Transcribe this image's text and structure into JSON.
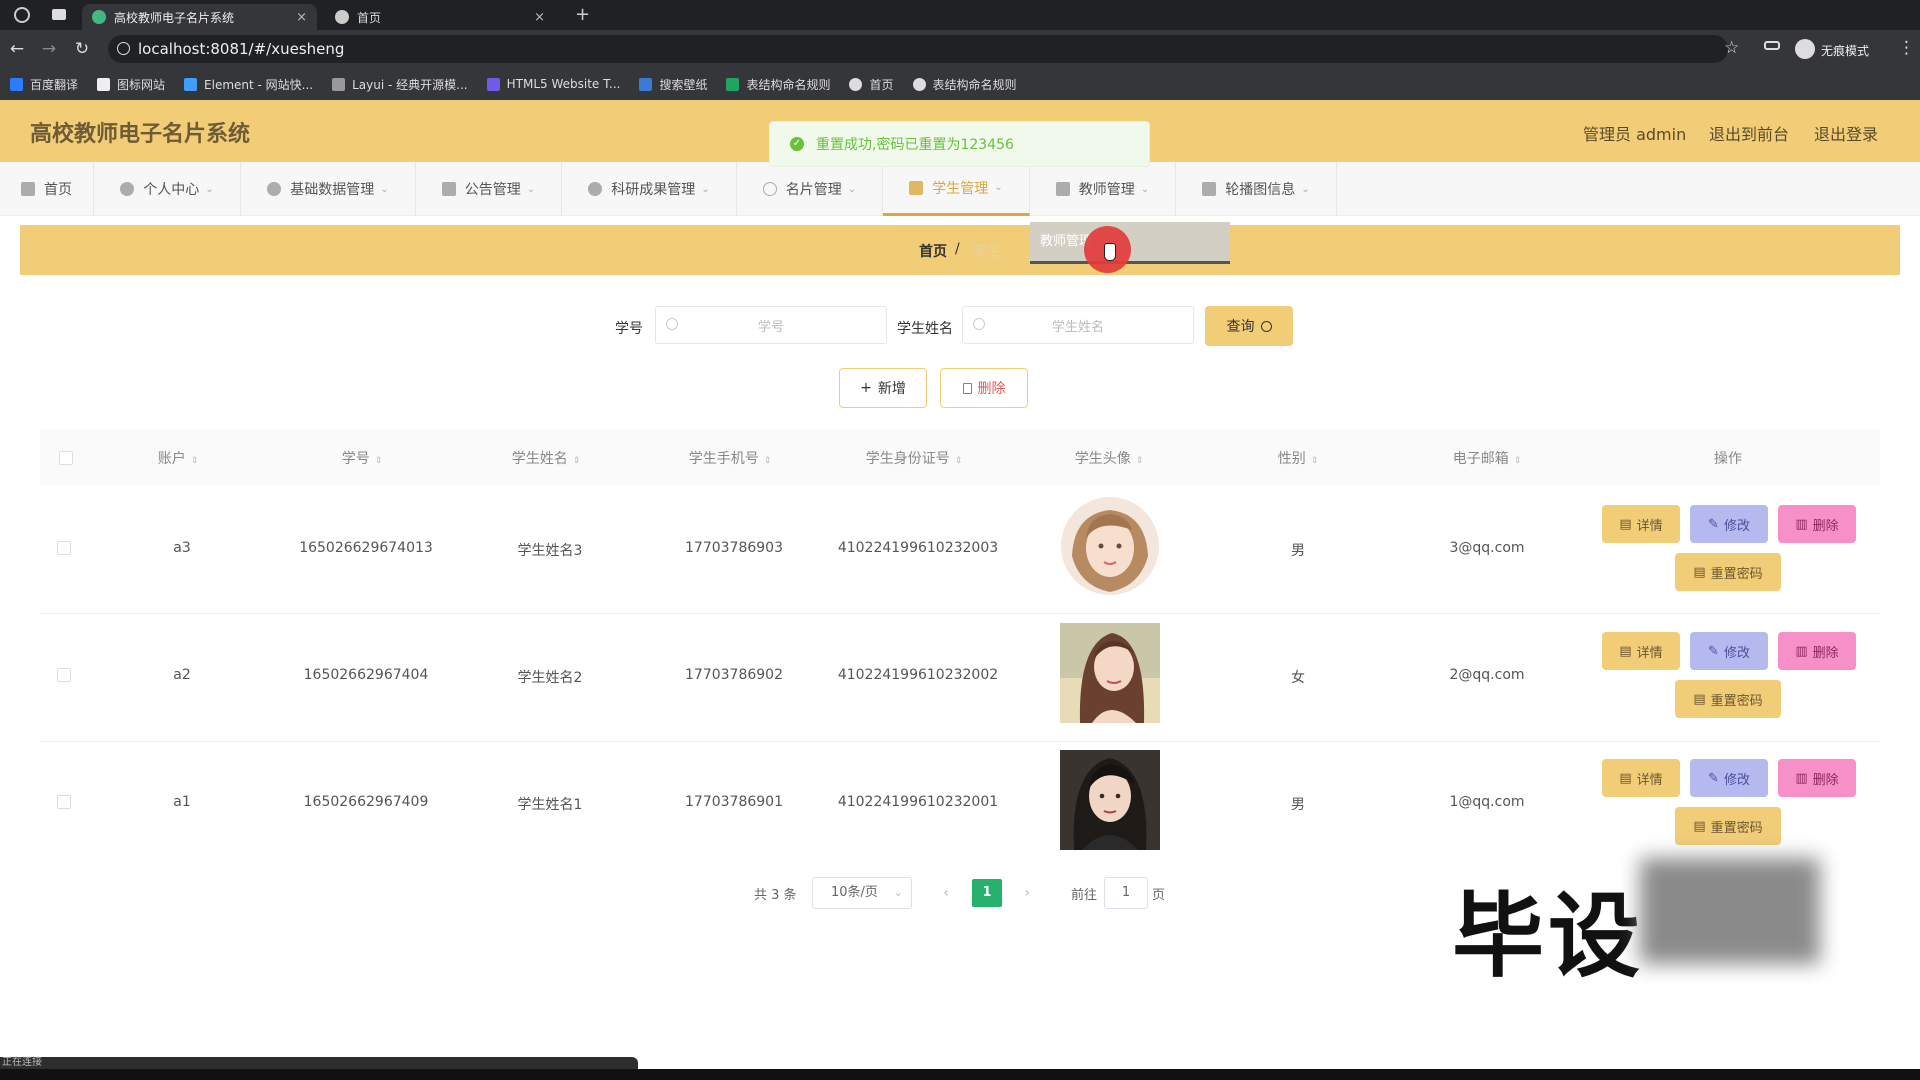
{
  "browser": {
    "tabs": [
      {
        "title": "高校教师电子名片系统",
        "active": true
      },
      {
        "title": "首页",
        "active": false
      }
    ],
    "new_tab": "+",
    "url": "localhost:8081/#/xuesheng",
    "profile": "无痕模式",
    "bookmarks": [
      "百度翻译",
      "图标网站",
      "Element - 网站快...",
      "Layui - 经典开源模...",
      "HTML5 Website T...",
      "搜索壁纸",
      "表结构命名规则",
      "首页",
      "表结构命名规则"
    ]
  },
  "header": {
    "title": "高校教师电子名片系统",
    "user": "管理员 admin",
    "to_front": "退出到前台",
    "logout": "退出登录"
  },
  "toast": {
    "message": "重置成功,密码已重置为123456"
  },
  "nav": {
    "items": [
      "首页",
      "个人中心",
      "基础数据管理",
      "公告管理",
      "科研成果管理",
      "名片管理",
      "学生管理",
      "教师管理",
      "轮播图信息"
    ],
    "active": "学生管理"
  },
  "dropdown": {
    "item": "教师管理"
  },
  "breadcrumb": {
    "home": "首页",
    "sep": "/",
    "current": "学生"
  },
  "search": {
    "label_id": "学号",
    "placeholder_id": "学号",
    "label_name": "学生姓名",
    "placeholder_name": "学生姓名",
    "query": "查询"
  },
  "actions": {
    "add": "新增",
    "delete": "删除"
  },
  "table": {
    "columns": [
      "账户",
      "学号",
      "学生姓名",
      "学生手机号",
      "学生身份证号",
      "学生头像",
      "性别",
      "电子邮箱",
      "操作"
    ],
    "rows": [
      {
        "account": "a3",
        "student_no": "165026629674013",
        "name": "学生姓名3",
        "phone": "17703786903",
        "id_card": "410224199610232003",
        "gender": "男",
        "email": "3@qq.com"
      },
      {
        "account": "a2",
        "student_no": "16502662967404",
        "name": "学生姓名2",
        "phone": "17703786902",
        "id_card": "410224199610232002",
        "gender": "女",
        "email": "2@qq.com"
      },
      {
        "account": "a1",
        "student_no": "16502662967409",
        "name": "学生姓名1",
        "phone": "17703786901",
        "id_card": "410224199610232001",
        "gender": "男",
        "email": "1@qq.com"
      }
    ],
    "op_labels": {
      "detail": "详情",
      "edit": "修改",
      "delete": "删除",
      "reset": "重置密码"
    }
  },
  "pagination": {
    "total": "共 3 条",
    "page_size": "10条/页",
    "current": "1",
    "goto": "前往",
    "goto_value": "1",
    "unit": "页"
  },
  "watermark": "毕设",
  "status": "正在连接"
}
